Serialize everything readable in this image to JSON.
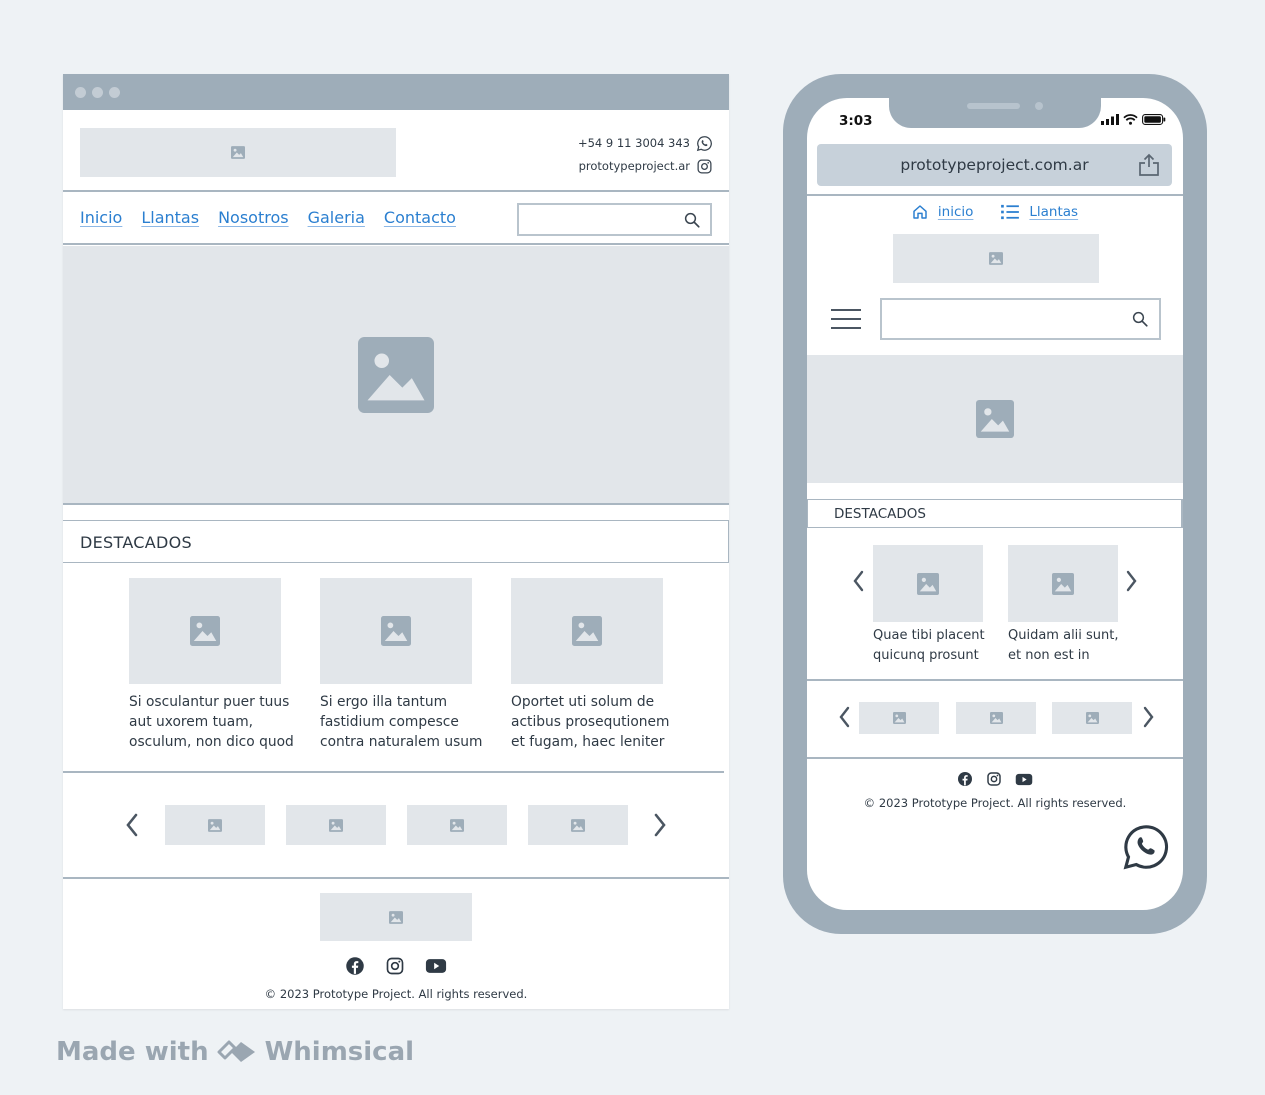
{
  "desktop": {
    "contact": {
      "phone": "+54 9 11 3004 343",
      "handle": "prototypeproject.ar"
    },
    "nav": [
      "Inicio",
      "Llantas",
      "Nosotros",
      "Galeria",
      "Contacto"
    ],
    "search": {
      "placeholder": ""
    },
    "featured_heading": "DESTACADOS",
    "cards": [
      {
        "lines": [
          "Si osculantur puer tuus",
          "aut uxorem tuam,",
          "osculum, non dico quod"
        ]
      },
      {
        "lines": [
          "Si ergo illa tantum",
          "fastidium compesce",
          "contra naturalem usum"
        ]
      },
      {
        "lines": [
          "Oportet uti solum de",
          "actibus prosequtionem",
          "et fugam, haec leniter"
        ]
      }
    ],
    "copyright": "© 2023 Prototype Project. All rights reserved."
  },
  "mobile": {
    "time": "3:03",
    "url": "prototypeproject.com.ar",
    "tabs": {
      "home": "inicio",
      "list": "Llantas"
    },
    "featured_heading": "DESTACADOS",
    "cards": [
      {
        "lines": [
          "Quae tibi placent",
          "quicunq prosunt"
        ]
      },
      {
        "lines": [
          "Quidam alii sunt,",
          "et non est in"
        ]
      }
    ],
    "copyright": "© 2023 Prototype Project. All rights reserved."
  },
  "brand": {
    "prefix": "Made with",
    "name": "Whimsical"
  },
  "colors": {
    "link": "#2b7fd0",
    "frame": "#9eadb9",
    "placeholder": "#e2e6ea",
    "background": "#eef2f5"
  }
}
